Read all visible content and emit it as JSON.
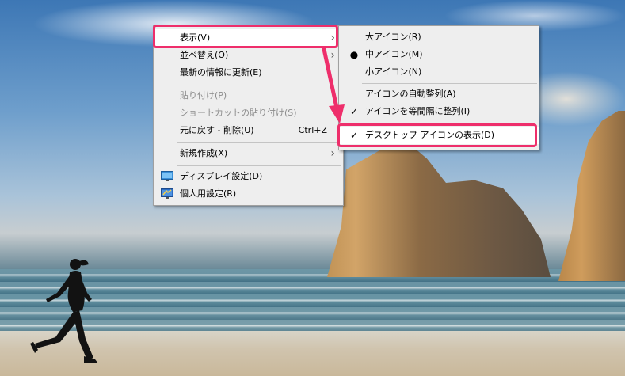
{
  "context_menu": {
    "items": [
      {
        "label": "表示(V)"
      },
      {
        "label": "並べ替え(O)"
      },
      {
        "label": "最新の情報に更新(E)"
      },
      {
        "label": "貼り付け(P)"
      },
      {
        "label": "ショートカットの貼り付け(S)"
      },
      {
        "label": "元に戻す - 削除(U)",
        "shortcut": "Ctrl+Z"
      },
      {
        "label": "新規作成(X)"
      },
      {
        "label": "ディスプレイ設定(D)"
      },
      {
        "label": "個人用設定(R)"
      }
    ]
  },
  "view_submenu": {
    "items": [
      {
        "label": "大アイコン(R)"
      },
      {
        "label": "中アイコン(M)",
        "mark": "●"
      },
      {
        "label": "小アイコン(N)"
      },
      {
        "label": "アイコンの自動整列(A)"
      },
      {
        "label": "アイコンを等間隔に整列(I)",
        "mark": "✓"
      },
      {
        "label": "デスクトップ アイコンの表示(D)",
        "mark": "✓"
      }
    ]
  },
  "colors": {
    "highlight_border": "#ee2e6b",
    "menu_background": "#eeeeee"
  },
  "icons": {
    "submenu_arrow": "chevron-right-icon",
    "display_settings": "monitor-icon",
    "personalize": "personalize-icon"
  }
}
